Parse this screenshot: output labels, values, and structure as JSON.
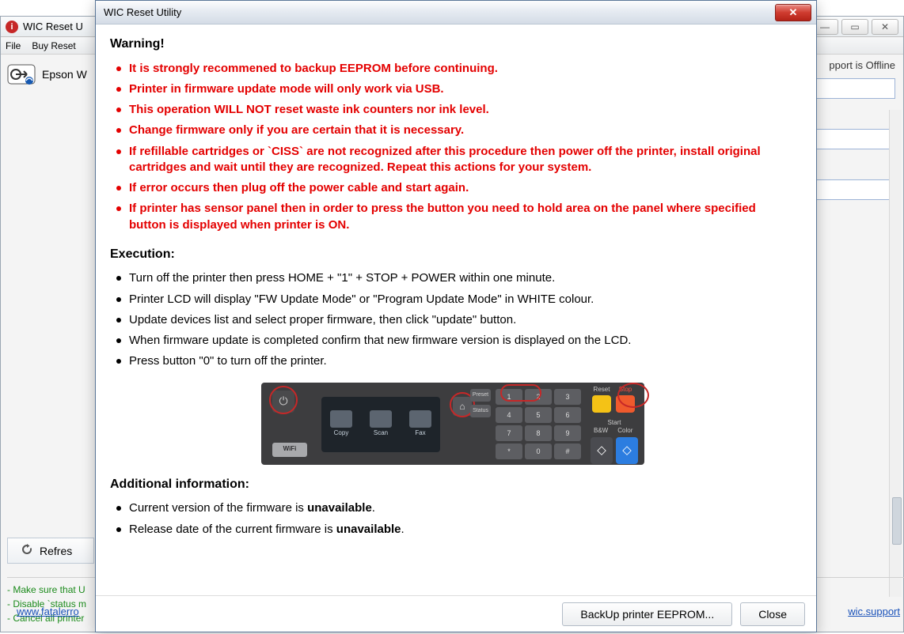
{
  "bg": {
    "title": "WIC Reset U",
    "menu": {
      "file": "File",
      "buy": "Buy Reset"
    },
    "printer_label": "Epson W",
    "support_status": "pport is Offline",
    "refresh_label": "Refres",
    "tips": [
      "- Make sure that U",
      "- Disable `status m",
      "- Cancel all printer"
    ],
    "link_left": "www.fatalerro",
    "link_right": "wic.support"
  },
  "dlg": {
    "title": "WIC Reset Utility",
    "warning_heading": "Warning!",
    "warnings": [
      "It is strongly recommened to backup EEPROM before continuing.",
      "Printer in firmware update mode will only work via USB.",
      "This operation WILL NOT reset waste ink counters nor ink level.",
      "Change firmware only if you are certain that it is necessary.",
      "If refillable cartridges or `CISS` are not recognized after this procedure then power off the printer, install original cartridges and wait until they are recognized. Repeat this actions for your system.",
      "If error occurs then plug off the power cable and start again.",
      "If printer has sensor panel then in order to press the button you need to hold area on the panel where specified button is displayed when printer is ON."
    ],
    "execution_heading": "Execution:",
    "execution": [
      "Turn off the printer then press HOME + \"1\" + STOP + POWER within one minute.",
      "Printer LCD will display \"FW Update Mode\" or \"Program Update Mode\" in WHITE colour.",
      "Update devices list and select proper firmware, then click \"update\" button.",
      "When firmware update is completed confirm that new firmware version is displayed on the LCD.",
      "Press button \"0\" to turn off the printer."
    ],
    "addinfo_heading": "Additional information:",
    "addinfo": {
      "line1_pre": "Current version of the firmware is ",
      "line1_bold": "unavailable",
      "line2_pre": "Release date of the current firmware is ",
      "line2_bold": "unavailable"
    },
    "panel": {
      "lcd_items": [
        "Copy",
        "Scan",
        "Fax"
      ],
      "side": {
        "preset": "Preset",
        "status": "Status"
      },
      "keypad": [
        "1",
        "2",
        "3",
        "4",
        "5",
        "6",
        "7",
        "8",
        "9",
        "*",
        "0",
        "#"
      ],
      "reset": "Reset",
      "stop": "Stop",
      "start": "Start",
      "bw": "B&W",
      "color": "Color",
      "wifi": "WiFi"
    },
    "buttons": {
      "backup": "BackUp printer EEPROM...",
      "close": "Close"
    }
  }
}
